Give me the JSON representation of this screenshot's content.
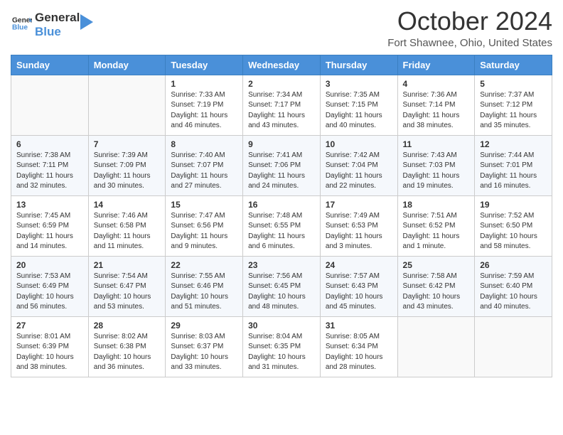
{
  "header": {
    "logo_line1": "General",
    "logo_line2": "Blue",
    "month_title": "October 2024",
    "location": "Fort Shawnee, Ohio, United States"
  },
  "days_of_week": [
    "Sunday",
    "Monday",
    "Tuesday",
    "Wednesday",
    "Thursday",
    "Friday",
    "Saturday"
  ],
  "weeks": [
    [
      {
        "day": "",
        "info": ""
      },
      {
        "day": "",
        "info": ""
      },
      {
        "day": "1",
        "info": "Sunrise: 7:33 AM\nSunset: 7:19 PM\nDaylight: 11 hours and 46 minutes."
      },
      {
        "day": "2",
        "info": "Sunrise: 7:34 AM\nSunset: 7:17 PM\nDaylight: 11 hours and 43 minutes."
      },
      {
        "day": "3",
        "info": "Sunrise: 7:35 AM\nSunset: 7:15 PM\nDaylight: 11 hours and 40 minutes."
      },
      {
        "day": "4",
        "info": "Sunrise: 7:36 AM\nSunset: 7:14 PM\nDaylight: 11 hours and 38 minutes."
      },
      {
        "day": "5",
        "info": "Sunrise: 7:37 AM\nSunset: 7:12 PM\nDaylight: 11 hours and 35 minutes."
      }
    ],
    [
      {
        "day": "6",
        "info": "Sunrise: 7:38 AM\nSunset: 7:11 PM\nDaylight: 11 hours and 32 minutes."
      },
      {
        "day": "7",
        "info": "Sunrise: 7:39 AM\nSunset: 7:09 PM\nDaylight: 11 hours and 30 minutes."
      },
      {
        "day": "8",
        "info": "Sunrise: 7:40 AM\nSunset: 7:07 PM\nDaylight: 11 hours and 27 minutes."
      },
      {
        "day": "9",
        "info": "Sunrise: 7:41 AM\nSunset: 7:06 PM\nDaylight: 11 hours and 24 minutes."
      },
      {
        "day": "10",
        "info": "Sunrise: 7:42 AM\nSunset: 7:04 PM\nDaylight: 11 hours and 22 minutes."
      },
      {
        "day": "11",
        "info": "Sunrise: 7:43 AM\nSunset: 7:03 PM\nDaylight: 11 hours and 19 minutes."
      },
      {
        "day": "12",
        "info": "Sunrise: 7:44 AM\nSunset: 7:01 PM\nDaylight: 11 hours and 16 minutes."
      }
    ],
    [
      {
        "day": "13",
        "info": "Sunrise: 7:45 AM\nSunset: 6:59 PM\nDaylight: 11 hours and 14 minutes."
      },
      {
        "day": "14",
        "info": "Sunrise: 7:46 AM\nSunset: 6:58 PM\nDaylight: 11 hours and 11 minutes."
      },
      {
        "day": "15",
        "info": "Sunrise: 7:47 AM\nSunset: 6:56 PM\nDaylight: 11 hours and 9 minutes."
      },
      {
        "day": "16",
        "info": "Sunrise: 7:48 AM\nSunset: 6:55 PM\nDaylight: 11 hours and 6 minutes."
      },
      {
        "day": "17",
        "info": "Sunrise: 7:49 AM\nSunset: 6:53 PM\nDaylight: 11 hours and 3 minutes."
      },
      {
        "day": "18",
        "info": "Sunrise: 7:51 AM\nSunset: 6:52 PM\nDaylight: 11 hours and 1 minute."
      },
      {
        "day": "19",
        "info": "Sunrise: 7:52 AM\nSunset: 6:50 PM\nDaylight: 10 hours and 58 minutes."
      }
    ],
    [
      {
        "day": "20",
        "info": "Sunrise: 7:53 AM\nSunset: 6:49 PM\nDaylight: 10 hours and 56 minutes."
      },
      {
        "day": "21",
        "info": "Sunrise: 7:54 AM\nSunset: 6:47 PM\nDaylight: 10 hours and 53 minutes."
      },
      {
        "day": "22",
        "info": "Sunrise: 7:55 AM\nSunset: 6:46 PM\nDaylight: 10 hours and 51 minutes."
      },
      {
        "day": "23",
        "info": "Sunrise: 7:56 AM\nSunset: 6:45 PM\nDaylight: 10 hours and 48 minutes."
      },
      {
        "day": "24",
        "info": "Sunrise: 7:57 AM\nSunset: 6:43 PM\nDaylight: 10 hours and 45 minutes."
      },
      {
        "day": "25",
        "info": "Sunrise: 7:58 AM\nSunset: 6:42 PM\nDaylight: 10 hours and 43 minutes."
      },
      {
        "day": "26",
        "info": "Sunrise: 7:59 AM\nSunset: 6:40 PM\nDaylight: 10 hours and 40 minutes."
      }
    ],
    [
      {
        "day": "27",
        "info": "Sunrise: 8:01 AM\nSunset: 6:39 PM\nDaylight: 10 hours and 38 minutes."
      },
      {
        "day": "28",
        "info": "Sunrise: 8:02 AM\nSunset: 6:38 PM\nDaylight: 10 hours and 36 minutes."
      },
      {
        "day": "29",
        "info": "Sunrise: 8:03 AM\nSunset: 6:37 PM\nDaylight: 10 hours and 33 minutes."
      },
      {
        "day": "30",
        "info": "Sunrise: 8:04 AM\nSunset: 6:35 PM\nDaylight: 10 hours and 31 minutes."
      },
      {
        "day": "31",
        "info": "Sunrise: 8:05 AM\nSunset: 6:34 PM\nDaylight: 10 hours and 28 minutes."
      },
      {
        "day": "",
        "info": ""
      },
      {
        "day": "",
        "info": ""
      }
    ]
  ]
}
